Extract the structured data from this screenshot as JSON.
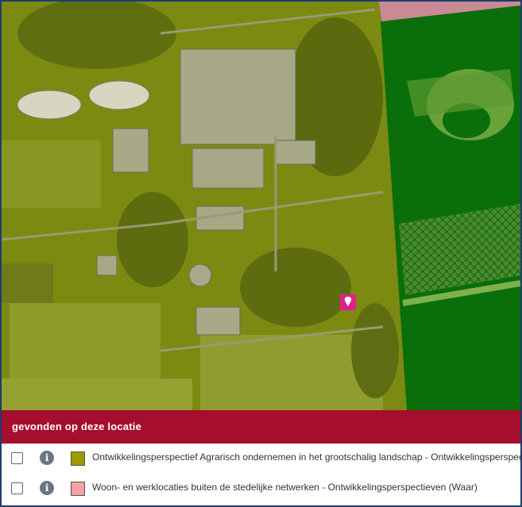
{
  "map": {
    "layers": [
      {
        "name": "agrarisch-overlay",
        "color": "#9c9c00"
      },
      {
        "name": "green-overlay",
        "color": "#0a7a0a"
      },
      {
        "name": "pink-overlay",
        "color": "#e88a9a"
      }
    ],
    "marker_icon": "location-marker-icon",
    "marker_color": "#e0208a"
  },
  "panel": {
    "header": "gevonden op deze locatie",
    "rows": [
      {
        "label": "Ontwikkelingsperspectief Agrarisch ondernemen in het grootschalig landschap - Ontwikkelingsperspectieven (Waar)",
        "swatch_color": "#9c9c00",
        "info_icon": "info-icon",
        "checked": false
      },
      {
        "label": "Woon- en werklocaties buiten de stedelijke netwerken - Ontwikkelingsperspectieven (Waar)",
        "swatch_color": "#f4a0a4",
        "info_icon": "info-icon",
        "checked": false
      }
    ]
  }
}
